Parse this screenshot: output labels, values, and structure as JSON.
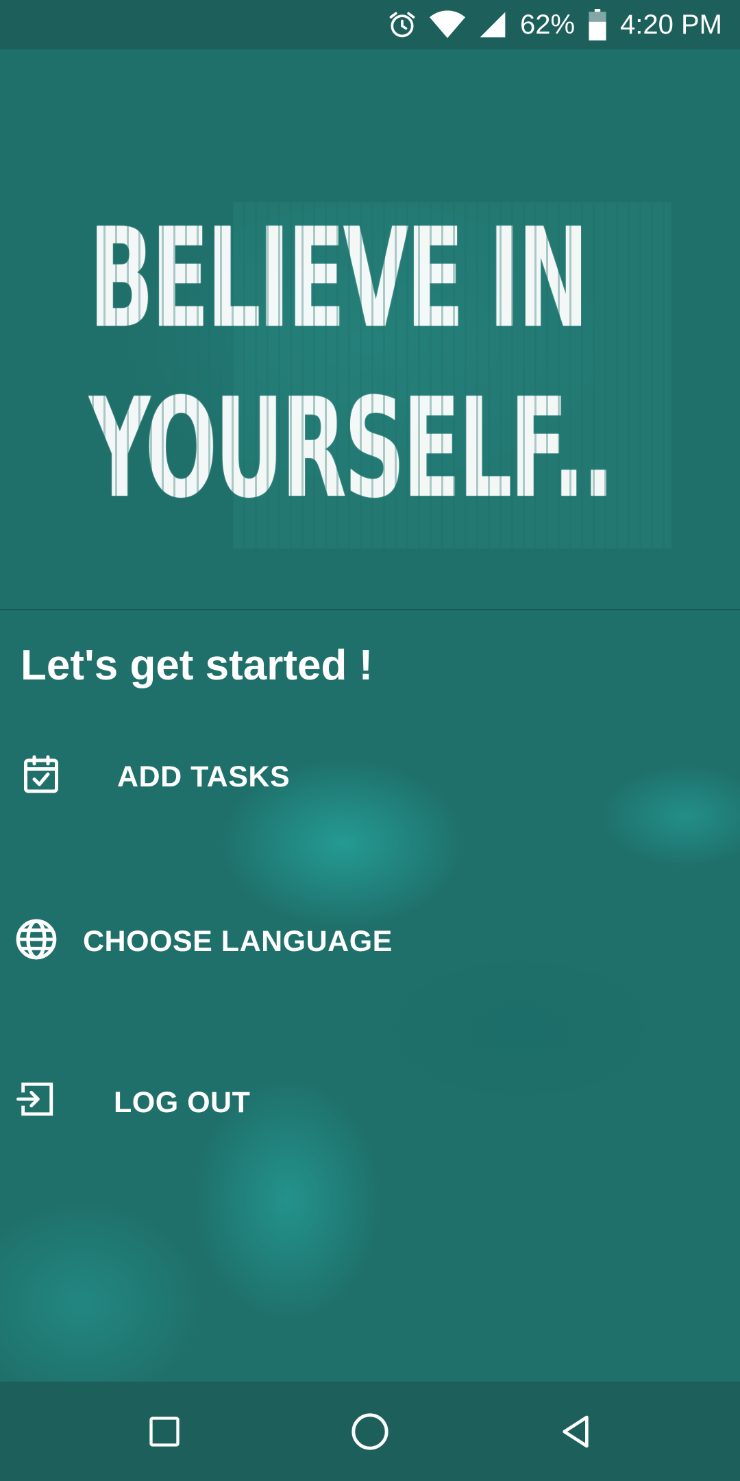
{
  "status_bar": {
    "battery": "62%",
    "time": "4:20 PM",
    "icons": [
      "alarm-icon",
      "wifi-icon",
      "signal-icon",
      "battery-icon"
    ]
  },
  "poster": {
    "line1": "BELIEVE IN",
    "line2": "YOURSELF.."
  },
  "main": {
    "heading": "Let's get started !",
    "menu": [
      {
        "label": "ADD TASKS",
        "icon": "calendar-check-icon"
      },
      {
        "label": "CHOOSE LANGUAGE",
        "icon": "globe-icon"
      },
      {
        "label": "LOG OUT",
        "icon": "logout-icon"
      }
    ]
  },
  "nav_bar": {
    "buttons": [
      "recents-square-icon",
      "home-circle-icon",
      "back-triangle-icon"
    ]
  },
  "colors": {
    "background": "#1f6f6a",
    "bars": "#1d605b",
    "text": "#ffffff"
  }
}
